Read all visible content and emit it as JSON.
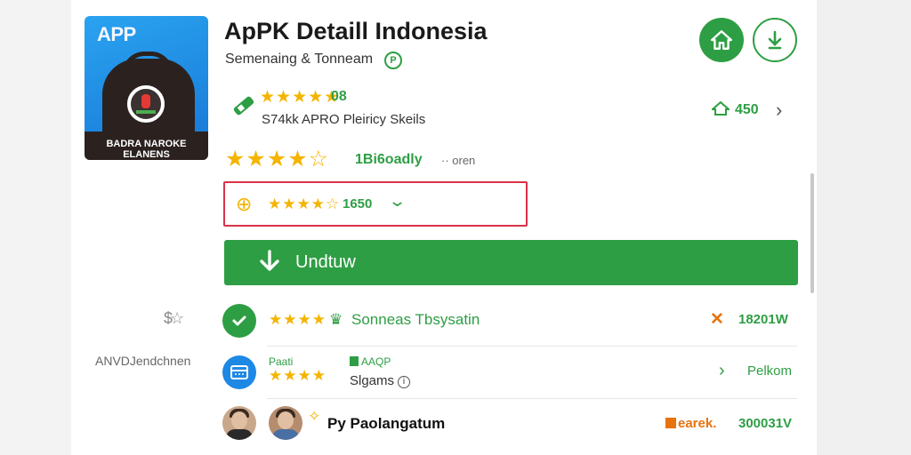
{
  "header": {
    "icon_tag": "APP",
    "icon_band_line1": "BADRA NAROKE",
    "icon_band_line2": "ELANENS",
    "title": "ApPK Detaill Indonesia",
    "subtitle": "Semenaing & Tonneam",
    "subtitle_badge": "P"
  },
  "row1": {
    "stars": "★★★★★",
    "number": "08",
    "description": "S74kk APRO Pleiricy Skeils",
    "right_count": "450"
  },
  "row2": {
    "stars": "★★★★☆",
    "rating_text": "1Bi6oadly",
    "extra": "·· oren"
  },
  "selected": {
    "stars": "★★★★☆",
    "value": "1650"
  },
  "download_label": "Undtuw",
  "side": {
    "label": "ANVDJendchnen"
  },
  "list": {
    "row1": {
      "stars": "★★★★",
      "label": "Sonneas Tbsysatin",
      "count": "18201W"
    },
    "row2": {
      "small": "Paati",
      "stars": "★★★★",
      "app": "AAQP",
      "name": "Slgams",
      "link": "Pelkom"
    },
    "row3": {
      "name": "Py Paolangatum",
      "badge": "earek.",
      "count": "300031V"
    }
  },
  "colors": {
    "accent": "#2e9e44",
    "star": "#f4b400",
    "highlight_border": "#d9314a",
    "warning": "#e8730e",
    "icon_blue": "#1e88e5"
  },
  "icons": [
    "app-logo-icon",
    "home-icon",
    "download-icon",
    "pencil-icon",
    "house-icon",
    "chevron-right-icon",
    "lock-icon",
    "chevron-down-icon",
    "check-icon",
    "crown-icon",
    "x-icon",
    "calendar-icon",
    "info-icon",
    "avatar",
    "sparkle-icon"
  ]
}
